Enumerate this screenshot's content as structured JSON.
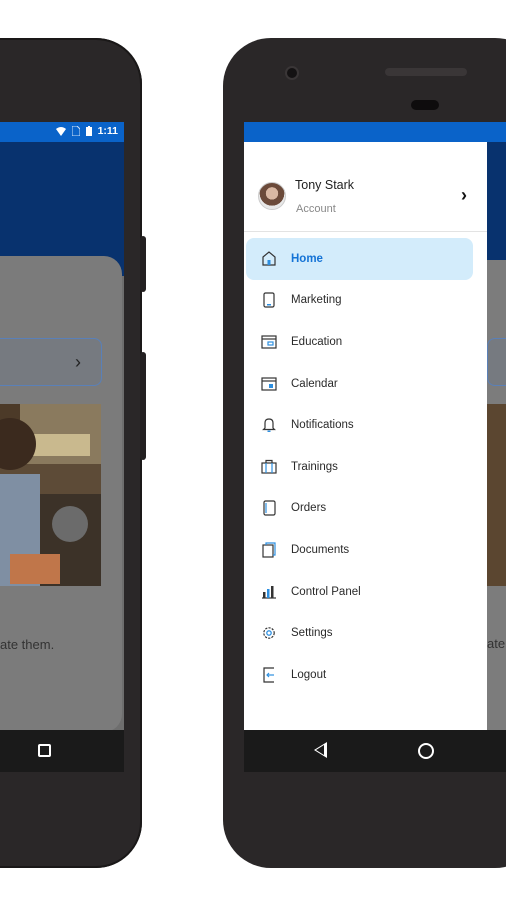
{
  "left_phone": {
    "status_time": "1:11",
    "caption": "ate them."
  },
  "right_phone": {
    "account": {
      "name": "Tony Stark",
      "subtitle": "Account"
    },
    "menu": [
      {
        "label": "Home",
        "icon": "home-icon",
        "active": true
      },
      {
        "label": "Marketing",
        "icon": "phone-icon",
        "active": false
      },
      {
        "label": "Education",
        "icon": "book-icon",
        "active": false
      },
      {
        "label": "Calendar",
        "icon": "calendar-icon",
        "active": false
      },
      {
        "label": "Notifications",
        "icon": "bell-icon",
        "active": false
      },
      {
        "label": "Trainings",
        "icon": "briefcase-icon",
        "active": false
      },
      {
        "label": "Orders",
        "icon": "tablet-icon",
        "active": false
      },
      {
        "label": "Documents",
        "icon": "document-icon",
        "active": false
      },
      {
        "label": "Control Panel",
        "icon": "bar-chart-icon",
        "active": false
      },
      {
        "label": "Settings",
        "icon": "gear-icon",
        "active": false
      },
      {
        "label": "Logout",
        "icon": "logout-icon",
        "active": false
      }
    ],
    "caption_fragment": "ate"
  },
  "colors": {
    "status_bar": "#0a63c9",
    "header_dark": "#08326e",
    "active_bg": "#d3ecfb",
    "active_text": "#1473d6",
    "icon_blue": "#2d8fe0"
  }
}
